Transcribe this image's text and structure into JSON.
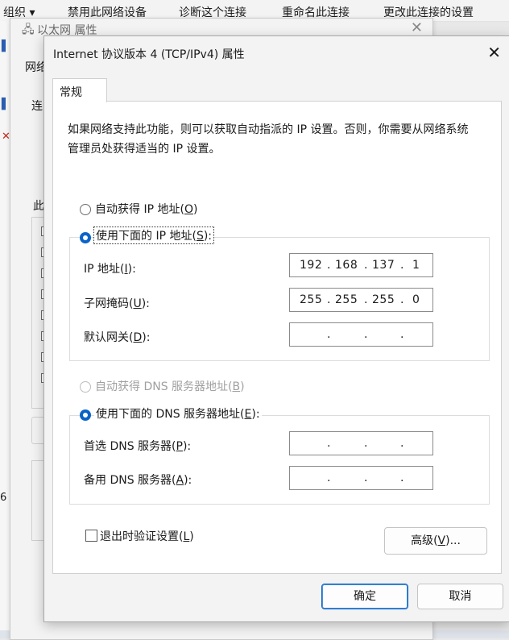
{
  "explorer_toolbar": {
    "items": [
      "组织 ▾",
      "禁用此网络设备",
      "诊断这个连接",
      "重命名此连接",
      "更改此连接的设置"
    ]
  },
  "ethernet_window": {
    "title": "以太网 属性",
    "tab_fragment": "网络",
    "connect_fragment": "连",
    "items_fragment": "此",
    "left_digit": "6"
  },
  "dialog": {
    "title": "Internet 协议版本 4 (TCP/IPv4) 属性",
    "tab_general": "常规",
    "description": "如果网络支持此功能，则可以获取自动指派的 IP 设置。否则，你需要从网络系统管理员处获得适当的 IP 设置。",
    "auto_ip": {
      "label": "自动获得 IP 地址",
      "key": "O",
      "selected": false
    },
    "manual_ip": {
      "label": "使用下面的 IP 地址",
      "key": "S",
      "selected": true
    },
    "ip_address": {
      "label": "IP 地址",
      "key": "I",
      "octets": [
        "192",
        "168",
        "137",
        "1"
      ]
    },
    "subnet_mask": {
      "label": "子网掩码",
      "key": "U",
      "octets": [
        "255",
        "255",
        "255",
        "0"
      ]
    },
    "gateway": {
      "label": "默认网关",
      "key": "D",
      "octets": [
        "",
        "",
        "",
        ""
      ]
    },
    "auto_dns": {
      "label": "自动获得 DNS 服务器地址",
      "key": "B",
      "selected": false,
      "disabled": true
    },
    "manual_dns": {
      "label": "使用下面的 DNS 服务器地址",
      "key": "E",
      "selected": true
    },
    "preferred_dns": {
      "label": "首选 DNS 服务器",
      "key": "P",
      "octets": [
        "",
        "",
        "",
        ""
      ]
    },
    "alternate_dns": {
      "label": "备用 DNS 服务器",
      "key": "A",
      "octets": [
        "",
        "",
        "",
        ""
      ]
    },
    "validate_on_exit": {
      "label": "退出时验证设置",
      "key": "L",
      "checked": false
    },
    "advanced_button": {
      "label": "高级",
      "key": "V",
      "suffix": "..."
    },
    "ok_button": "确定",
    "cancel_button": "取消"
  },
  "colors": {
    "accent": "#0a64c8",
    "window_bg": "#f3f3f3",
    "panel_bg": "#ffffff"
  }
}
